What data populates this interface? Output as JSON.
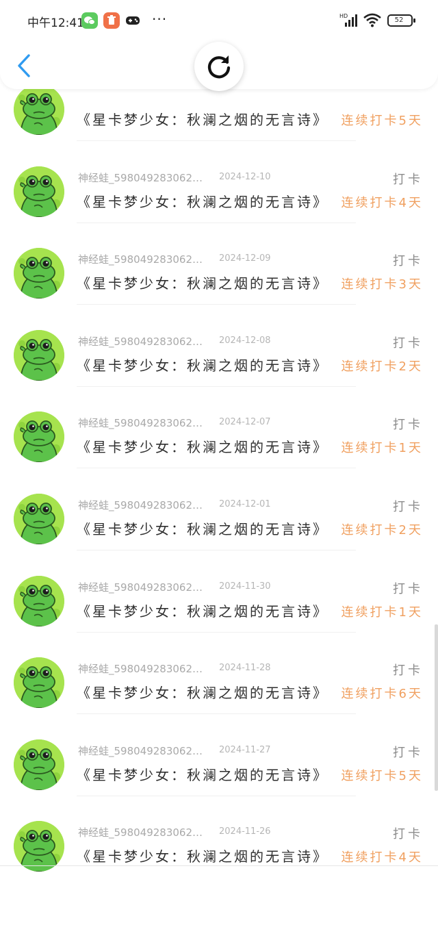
{
  "status_bar": {
    "time": "中午12:41",
    "battery": "52",
    "network": "HD",
    "more": "···"
  },
  "header": {
    "back_icon": "chevron-left-icon",
    "refresh_icon": "refresh-icon"
  },
  "records": [
    {
      "user": "",
      "date": "",
      "tag": "",
      "title": "《星卡梦少女：秋澜之烟的无言诗》",
      "streak": "连续打卡5天"
    },
    {
      "user": "神经蛙_598049283062…",
      "date": "2024-12-10",
      "tag": "打卡",
      "title": "《星卡梦少女：秋澜之烟的无言诗》",
      "streak": "连续打卡4天"
    },
    {
      "user": "神经蛙_598049283062…",
      "date": "2024-12-09",
      "tag": "打卡",
      "title": "《星卡梦少女：秋澜之烟的无言诗》",
      "streak": "连续打卡3天"
    },
    {
      "user": "神经蛙_598049283062…",
      "date": "2024-12-08",
      "tag": "打卡",
      "title": "《星卡梦少女：秋澜之烟的无言诗》",
      "streak": "连续打卡2天"
    },
    {
      "user": "神经蛙_598049283062…",
      "date": "2024-12-07",
      "tag": "打卡",
      "title": "《星卡梦少女：秋澜之烟的无言诗》",
      "streak": "连续打卡1天"
    },
    {
      "user": "神经蛙_598049283062…",
      "date": "2024-12-01",
      "tag": "打卡",
      "title": "《星卡梦少女：秋澜之烟的无言诗》",
      "streak": "连续打卡2天"
    },
    {
      "user": "神经蛙_598049283062…",
      "date": "2024-11-30",
      "tag": "打卡",
      "title": "《星卡梦少女：秋澜之烟的无言诗》",
      "streak": "连续打卡1天"
    },
    {
      "user": "神经蛙_598049283062…",
      "date": "2024-11-28",
      "tag": "打卡",
      "title": "《星卡梦少女：秋澜之烟的无言诗》",
      "streak": "连续打卡6天"
    },
    {
      "user": "神经蛙_598049283062…",
      "date": "2024-11-27",
      "tag": "打卡",
      "title": "《星卡梦少女：秋澜之烟的无言诗》",
      "streak": "连续打卡5天"
    },
    {
      "user": "神经蛙_598049283062…",
      "date": "2024-11-26",
      "tag": "打卡",
      "title": "《星卡梦少女：秋澜之烟的无言诗》",
      "streak": "连续打卡4天"
    }
  ],
  "colors": {
    "accent": "#2f9bf0",
    "streak": "#f0a060",
    "avatar_bg": "#a6e34e",
    "frog": "#5cc24a"
  }
}
